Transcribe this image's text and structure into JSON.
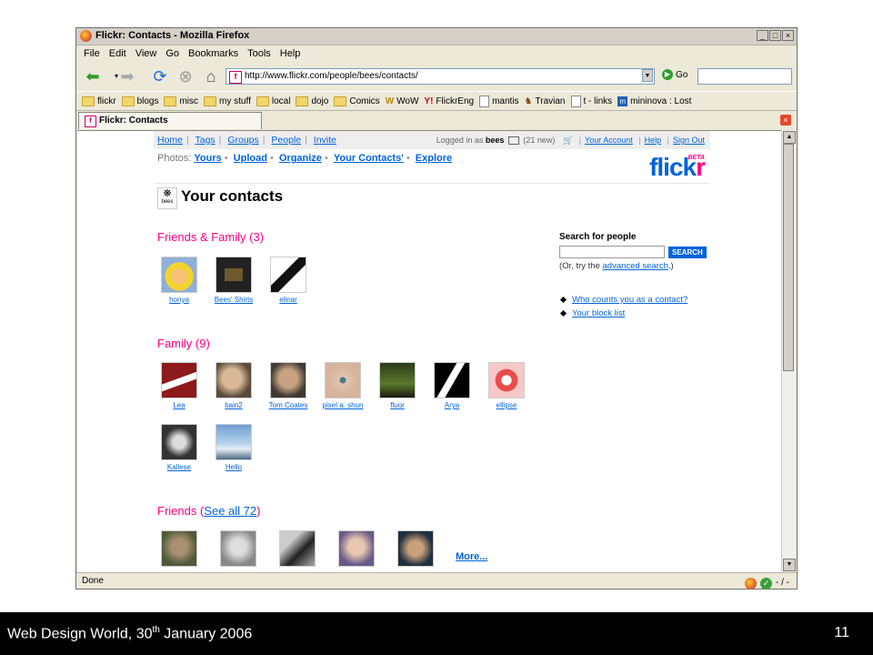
{
  "window": {
    "title": "Flickr: Contacts - Mozilla Firefox",
    "buttons": [
      "_",
      "□",
      "×"
    ]
  },
  "menu": [
    "File",
    "Edit",
    "View",
    "Go",
    "Bookmarks",
    "Tools",
    "Help"
  ],
  "nav": {
    "url": "http://www.flickr.com/people/bees/contacts/",
    "go_label": "Go"
  },
  "bookmarks": [
    "flickr",
    "blogs",
    "misc",
    "my stuff",
    "local",
    "dojo",
    "Comics",
    "WoW",
    "FlickrEng",
    "mantis",
    "Travian",
    "t - links",
    "mininova : Lost"
  ],
  "tab": {
    "label": "Flickr: Contacts"
  },
  "status": {
    "text": "Done",
    "right": "- / -"
  },
  "flickr": {
    "top_links": [
      "Home",
      "Tags",
      "Groups",
      "People",
      "Invite"
    ],
    "logged_in_prefix": "Logged in as",
    "user": "bees",
    "new_count": "(21 new)",
    "account_links": [
      "Your Account",
      "Help",
      "Sign Out"
    ],
    "photos_label": "Photos:",
    "photos_links": [
      "Yours",
      "Upload",
      "Organize",
      "Your Contacts'",
      "Explore"
    ],
    "logo_fl": "flick",
    "logo_r": "r",
    "logo_beta": "BETA",
    "buddy_label": "bees",
    "page_title": "Your contacts",
    "sections": {
      "friends_family": {
        "title": "Friends & Family (3)",
        "people": [
          "honya",
          "Bees' Shirts",
          "elinar"
        ]
      },
      "family": {
        "title": "Family (9)",
        "people": [
          "Lea",
          "bain2",
          "Tom Coates",
          "pixel a. shun",
          "fluor",
          "Arya",
          "ellipse",
          "Kallese",
          "Hello"
        ]
      },
      "friends": {
        "title_pre": "Friends (",
        "title_link": "See all 72",
        "title_post": ")",
        "more": "More..."
      }
    },
    "search": {
      "label": "Search for people",
      "button": "SEARCH",
      "hint_pre": "(Or, try the ",
      "hint_link": "advanced search",
      "hint_post": ".)"
    },
    "side_links": [
      "Who counts you as a contact?",
      "Your block list"
    ]
  },
  "footer": {
    "left_pre": "Web Design World, 30",
    "left_sup": "th",
    "left_post": " January 2006",
    "page": "11"
  }
}
